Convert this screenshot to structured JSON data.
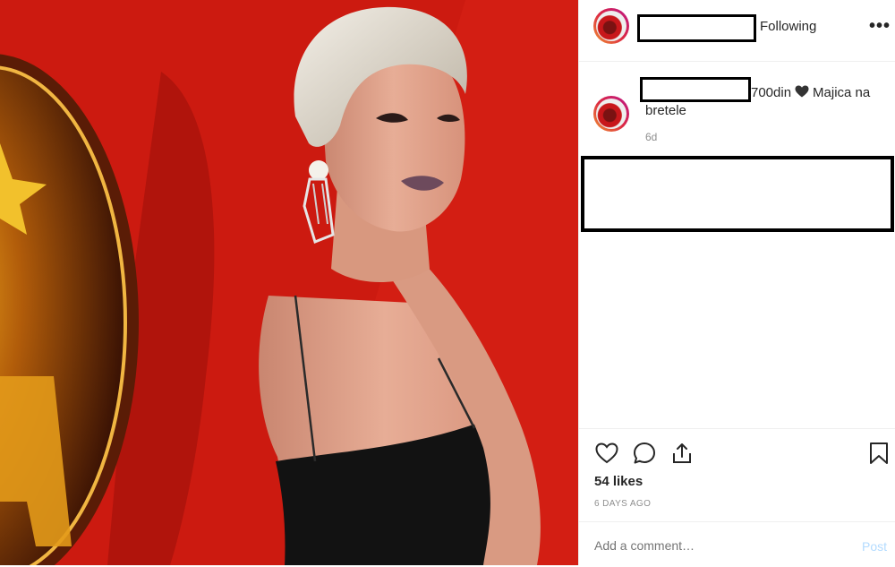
{
  "header": {
    "follow_label": "Following",
    "more_label": "•••"
  },
  "caption": {
    "text": "700din",
    "text_rest": "Majica na bretele",
    "age": "6d"
  },
  "actions": {
    "likes": "54 likes",
    "posted": "6 DAYS AGO"
  },
  "comment": {
    "placeholder": "Add a comment…",
    "post_label": "Post"
  },
  "colors": {
    "photo_background": "#c8170d",
    "post_disabled": "#b3dbff",
    "muted_text": "#8e8e8e"
  },
  "icons": [
    "like-icon",
    "comment-icon",
    "share-icon",
    "bookmark-icon",
    "more-icon",
    "heart-icon"
  ]
}
